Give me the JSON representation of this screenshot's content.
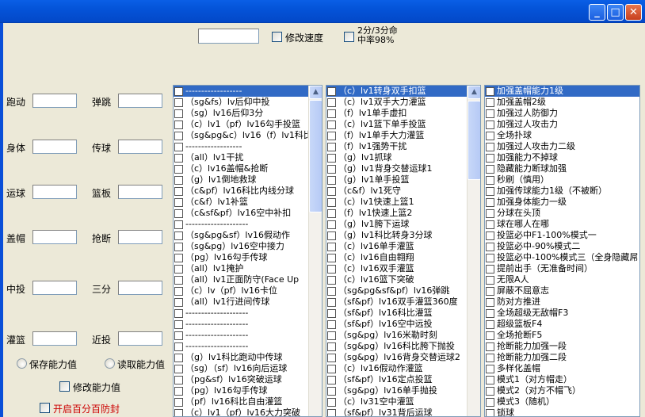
{
  "window": {
    "title": "",
    "minimize": "_",
    "maximize": "□",
    "close": "✕"
  },
  "top": {
    "speed_input": "",
    "speed_checkbox_label": "修改速度",
    "shot_checkbox_label_line1": "2分/3分命",
    "shot_checkbox_label_line2": "中率98%"
  },
  "attributes": [
    {
      "label": "跑动",
      "value": ""
    },
    {
      "label": "弹跳",
      "value": ""
    },
    {
      "label": "身体",
      "value": ""
    },
    {
      "label": "传球",
      "value": ""
    },
    {
      "label": "运球",
      "value": ""
    },
    {
      "label": "篮板",
      "value": ""
    },
    {
      "label": "盖帽",
      "value": ""
    },
    {
      "label": "抢断",
      "value": ""
    },
    {
      "label": "中投",
      "value": ""
    },
    {
      "label": "三分",
      "value": ""
    },
    {
      "label": "灌篮",
      "value": ""
    },
    {
      "label": "近投",
      "value": ""
    }
  ],
  "controls": {
    "save_radio": "保存能力值",
    "load_radio": "读取能力值",
    "modify_checkbox": "修改能力值",
    "antiban_checkbox": "开启百分百防封",
    "antiban_color": "#CC0000"
  },
  "lists": [
    {
      "selected": 0,
      "items": [
        "------------------",
        "（sg&fs）lv后仰中投",
        "（sg）lv16后仰3分",
        "（c）lv1（pf）lv16勾手投篮",
        "（sg&pg&c）lv16（f）lv1科比",
        "------------------",
        "（all）lv1干扰",
        "（c）lv16盖帽&抢断",
        "（g）lv1倒地救球",
        "（c&pf）lv16科比内线分球",
        "（c&f）lv1补篮",
        "（c&sf&pf）lv16空中补扣",
        "--------------------",
        "（sg&pg&sf）lv16假动作",
        "（sg&pg）lv16空中接力",
        "（pg）lv16勾手传球",
        "（all）lv1掩护",
        "（all）lv1正面防守(Face Up",
        "（c）lv（pf）lv16卡位",
        "（all）lv1行进间传球",
        "--------------------",
        "--------------------",
        "--------------------",
        "--------------------",
        "（g）lv1科比跑动中传球",
        "（sg）（sf）lv16向后运球",
        "（pg&sf）lv16突破运球",
        "（pg）lv16勾手传球",
        "（pf）lv16科比自由灌篮",
        "（c）lv1（pf）lv16大力突破"
      ]
    },
    {
      "selected": 0,
      "items": [
        "（c）lv1转身双手扣篮",
        "（c）lv1双手大力灌篮",
        "（f）lv1单手虚扣",
        "（c）lv1篮下单手投篮",
        "（f）lv1单手大力灌篮",
        "（f）lv1强势干扰",
        "（g）lv1抓球",
        "（g）lv1背身交替运球1",
        "（g）lv1单手投篮",
        "（c&f）lv1死守",
        "（c）lv1快速上篮1",
        "（f）lv1快速上篮2",
        "（g）lv1胯下运球",
        "（g）lv1科比转身3分球",
        "（c）lv16单手灌篮",
        "（c）lv16自由翱翔",
        "（c）lv16双手灌篮",
        "（c）lv16篮下突破",
        "（sg&pg&sf&pf）lv16弹跳",
        "（sf&pf）lv16双手灌篮360度",
        "（sf&pf）lv16科比灌篮",
        "（sf&pf）lv16空中远投",
        "（sg&pg）lv16米勒时刻",
        "（sg&pg）lv16科比胯下抛投",
        "（sg&pg）lv16背身交替运球2",
        "（c）lv16假动作灌篮",
        "（sf&pf）lv16定点投篮",
        "（sg&pg）lv16单手抛投",
        "（c）lv31空中灌篮",
        "（sf&pf）lv31背后运球"
      ]
    },
    {
      "selected": 0,
      "items": [
        "加强盖帽能力1级",
        "加强盖帽2级",
        "加强过人防御力",
        "加强过人攻击力",
        "全场扑球",
        "加强过人攻击力二级",
        "加强能力不掉球",
        "隐藏能力断球加强",
        "秒刷（慎用）",
        "加强传球能力1级（不被断）",
        "加强身体能力一级",
        "分球在头顶",
        "球在哪人在哪",
        "投篮必中F1-100%模式一",
        "投篮必中-90%模式二",
        "投篮必中-100%模式三（全身隐藏屌",
        "提前出手（无准备时间）",
        "无限A人",
        "屏蔽不屈意志",
        "防对方推进",
        "全场超级无敌帽F3",
        "超级篮板F4",
        "全场抢断F5",
        "抢断能力加强一段",
        "抢断能力加强二段",
        "多样化盖帽",
        "模式1（对方帽走）",
        "模式2（对方不帽飞）",
        "模式3（随机）",
        "锁球"
      ]
    }
  ]
}
